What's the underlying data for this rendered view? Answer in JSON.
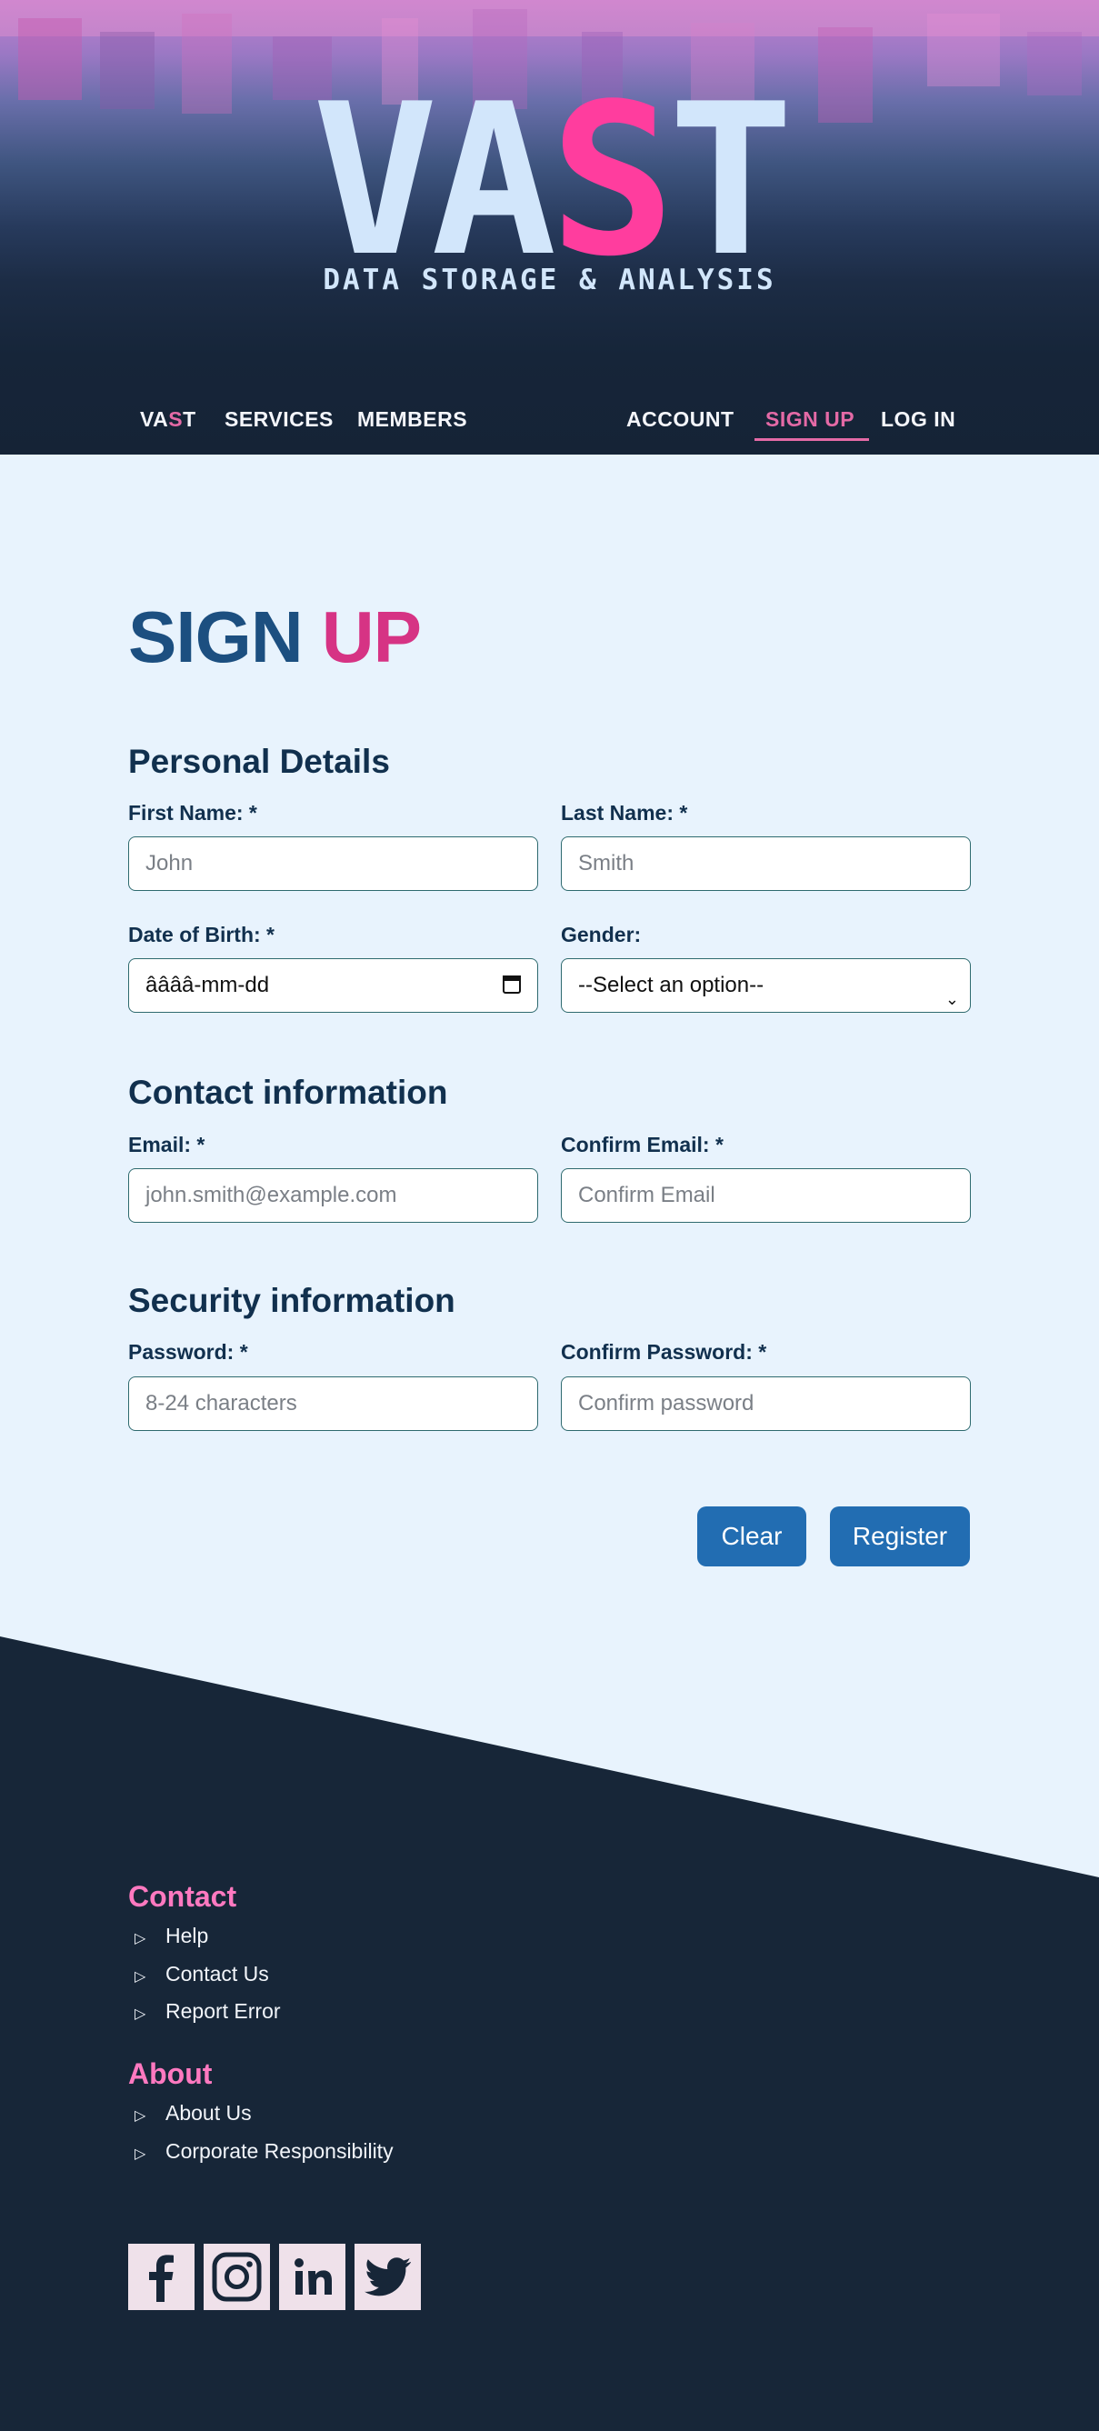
{
  "header": {
    "logo_part1": "VA",
    "logo_part2": "S",
    "logo_part3": "T",
    "tagline": "DATA STORAGE & ANALYSIS"
  },
  "nav": {
    "brand_part1": "VA",
    "brand_part2": "S",
    "brand_part3": "T",
    "services": "SERVICES",
    "members": "MEMBERS",
    "account": "ACCOUNT",
    "signup": "SIGN UP",
    "login": "LOG IN"
  },
  "page": {
    "title_part1": "SIGN",
    "title_part2": "UP"
  },
  "personal": {
    "heading": "Personal Details",
    "first_name_label": "First Name: *",
    "first_name_placeholder": "John",
    "last_name_label": "Last Name: *",
    "last_name_placeholder": "Smith",
    "dob_label": "Date of Birth: *",
    "dob_value": "ââââ-mm-dd",
    "gender_label": "Gender:",
    "gender_value": "--Select an option--"
  },
  "contact": {
    "heading": "Contact information",
    "email_label": "Email: *",
    "email_placeholder": "john.smith@example.com",
    "confirm_email_label": "Confirm Email: *",
    "confirm_email_placeholder": "Confirm Email"
  },
  "security": {
    "heading": "Security information",
    "password_label": "Password: *",
    "password_placeholder": "8-24 characters",
    "confirm_password_label": "Confirm Password: *",
    "confirm_password_placeholder": "Confirm password"
  },
  "buttons": {
    "clear": "Clear",
    "register": "Register"
  },
  "footer": {
    "contact_heading": "Contact",
    "contact_items": [
      "Help",
      "Contact Us",
      "Report Error"
    ],
    "about_heading": "About",
    "about_items": [
      "About Us",
      "Corporate Responsibility"
    ],
    "bullet": "▷",
    "social": [
      "facebook-icon",
      "instagram-icon",
      "linkedin-icon",
      "twitter-icon"
    ]
  },
  "colors": {
    "accent_pink": "#ff3d9e",
    "primary_blue": "#226db2",
    "footer_bg": "#172638",
    "page_bg": "#e8f3fd"
  }
}
